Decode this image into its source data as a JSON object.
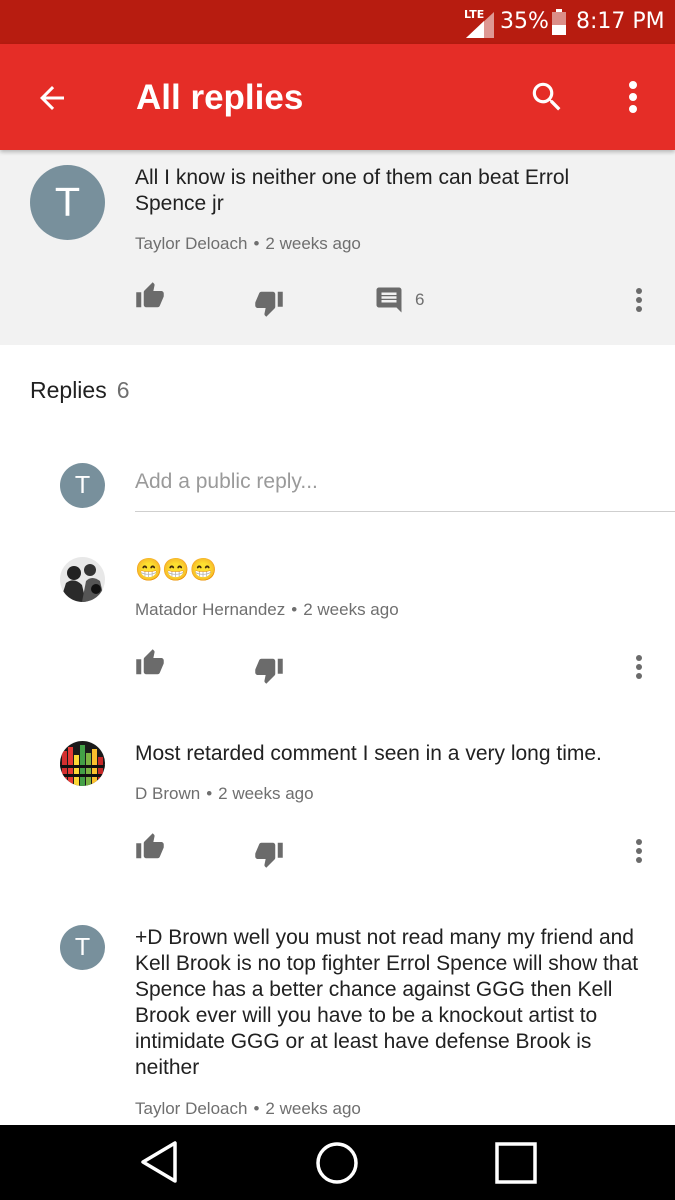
{
  "status": {
    "network": "LTE",
    "battery": "35%",
    "time": "8:17 PM"
  },
  "appbar": {
    "title": "All replies"
  },
  "parent_comment": {
    "avatar_letter": "T",
    "text": "All I know is neither one of them can beat Errol Spence jr",
    "author": "Taylor Deloach",
    "time": "2 weeks ago",
    "reply_count": "6"
  },
  "replies_header": {
    "label": "Replies",
    "count": "6"
  },
  "reply_box": {
    "avatar_letter": "T",
    "placeholder": "Add a public reply..."
  },
  "replies": [
    {
      "author": "Matador Hernandez",
      "time": "2 weeks ago",
      "text": "😁😁😁"
    },
    {
      "author": "D Brown",
      "time": "2 weeks ago",
      "text": "Most retarded comment I seen in a very long time."
    },
    {
      "avatar_letter": "T",
      "author": "Taylor Deloach",
      "time": "2 weeks ago",
      "text": "+D Brown well you must not read many my friend and Kell Brook is no top fighter Errol Spence will show that Spence has a better chance against GGG then Kell Brook ever will you have to be a knockout artist to intimidate GGG or at least have defense Brook is neither"
    }
  ],
  "separator": "•",
  "colors": {
    "statusbar": "#b71c10",
    "appbar": "#e52d27",
    "avatar": "#78909c",
    "parent_bg": "#f2f2f2"
  },
  "icons": [
    "back-arrow-icon",
    "search-icon",
    "more-vert-icon",
    "thumb-up-icon",
    "thumb-down-icon",
    "comment-icon",
    "nav-back-icon",
    "nav-home-icon",
    "nav-recents-icon"
  ]
}
